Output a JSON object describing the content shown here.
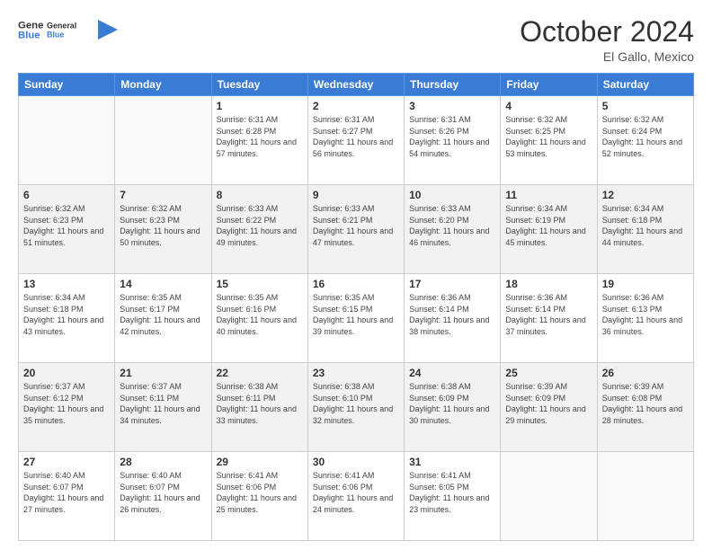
{
  "logo": {
    "line1": "General",
    "line2": "Blue"
  },
  "title": "October 2024",
  "subtitle": "El Gallo, Mexico",
  "days_header": [
    "Sunday",
    "Monday",
    "Tuesday",
    "Wednesday",
    "Thursday",
    "Friday",
    "Saturday"
  ],
  "weeks": [
    [
      {
        "day": "",
        "sunrise": "",
        "sunset": "",
        "daylight": ""
      },
      {
        "day": "",
        "sunrise": "",
        "sunset": "",
        "daylight": ""
      },
      {
        "day": "1",
        "sunrise": "Sunrise: 6:31 AM",
        "sunset": "Sunset: 6:28 PM",
        "daylight": "Daylight: 11 hours and 57 minutes."
      },
      {
        "day": "2",
        "sunrise": "Sunrise: 6:31 AM",
        "sunset": "Sunset: 6:27 PM",
        "daylight": "Daylight: 11 hours and 56 minutes."
      },
      {
        "day": "3",
        "sunrise": "Sunrise: 6:31 AM",
        "sunset": "Sunset: 6:26 PM",
        "daylight": "Daylight: 11 hours and 54 minutes."
      },
      {
        "day": "4",
        "sunrise": "Sunrise: 6:32 AM",
        "sunset": "Sunset: 6:25 PM",
        "daylight": "Daylight: 11 hours and 53 minutes."
      },
      {
        "day": "5",
        "sunrise": "Sunrise: 6:32 AM",
        "sunset": "Sunset: 6:24 PM",
        "daylight": "Daylight: 11 hours and 52 minutes."
      }
    ],
    [
      {
        "day": "6",
        "sunrise": "Sunrise: 6:32 AM",
        "sunset": "Sunset: 6:23 PM",
        "daylight": "Daylight: 11 hours and 51 minutes."
      },
      {
        "day": "7",
        "sunrise": "Sunrise: 6:32 AM",
        "sunset": "Sunset: 6:23 PM",
        "daylight": "Daylight: 11 hours and 50 minutes."
      },
      {
        "day": "8",
        "sunrise": "Sunrise: 6:33 AM",
        "sunset": "Sunset: 6:22 PM",
        "daylight": "Daylight: 11 hours and 49 minutes."
      },
      {
        "day": "9",
        "sunrise": "Sunrise: 6:33 AM",
        "sunset": "Sunset: 6:21 PM",
        "daylight": "Daylight: 11 hours and 47 minutes."
      },
      {
        "day": "10",
        "sunrise": "Sunrise: 6:33 AM",
        "sunset": "Sunset: 6:20 PM",
        "daylight": "Daylight: 11 hours and 46 minutes."
      },
      {
        "day": "11",
        "sunrise": "Sunrise: 6:34 AM",
        "sunset": "Sunset: 6:19 PM",
        "daylight": "Daylight: 11 hours and 45 minutes."
      },
      {
        "day": "12",
        "sunrise": "Sunrise: 6:34 AM",
        "sunset": "Sunset: 6:18 PM",
        "daylight": "Daylight: 11 hours and 44 minutes."
      }
    ],
    [
      {
        "day": "13",
        "sunrise": "Sunrise: 6:34 AM",
        "sunset": "Sunset: 6:18 PM",
        "daylight": "Daylight: 11 hours and 43 minutes."
      },
      {
        "day": "14",
        "sunrise": "Sunrise: 6:35 AM",
        "sunset": "Sunset: 6:17 PM",
        "daylight": "Daylight: 11 hours and 42 minutes."
      },
      {
        "day": "15",
        "sunrise": "Sunrise: 6:35 AM",
        "sunset": "Sunset: 6:16 PM",
        "daylight": "Daylight: 11 hours and 40 minutes."
      },
      {
        "day": "16",
        "sunrise": "Sunrise: 6:35 AM",
        "sunset": "Sunset: 6:15 PM",
        "daylight": "Daylight: 11 hours and 39 minutes."
      },
      {
        "day": "17",
        "sunrise": "Sunrise: 6:36 AM",
        "sunset": "Sunset: 6:14 PM",
        "daylight": "Daylight: 11 hours and 38 minutes."
      },
      {
        "day": "18",
        "sunrise": "Sunrise: 6:36 AM",
        "sunset": "Sunset: 6:14 PM",
        "daylight": "Daylight: 11 hours and 37 minutes."
      },
      {
        "day": "19",
        "sunrise": "Sunrise: 6:36 AM",
        "sunset": "Sunset: 6:13 PM",
        "daylight": "Daylight: 11 hours and 36 minutes."
      }
    ],
    [
      {
        "day": "20",
        "sunrise": "Sunrise: 6:37 AM",
        "sunset": "Sunset: 6:12 PM",
        "daylight": "Daylight: 11 hours and 35 minutes."
      },
      {
        "day": "21",
        "sunrise": "Sunrise: 6:37 AM",
        "sunset": "Sunset: 6:11 PM",
        "daylight": "Daylight: 11 hours and 34 minutes."
      },
      {
        "day": "22",
        "sunrise": "Sunrise: 6:38 AM",
        "sunset": "Sunset: 6:11 PM",
        "daylight": "Daylight: 11 hours and 33 minutes."
      },
      {
        "day": "23",
        "sunrise": "Sunrise: 6:38 AM",
        "sunset": "Sunset: 6:10 PM",
        "daylight": "Daylight: 11 hours and 32 minutes."
      },
      {
        "day": "24",
        "sunrise": "Sunrise: 6:38 AM",
        "sunset": "Sunset: 6:09 PM",
        "daylight": "Daylight: 11 hours and 30 minutes."
      },
      {
        "day": "25",
        "sunrise": "Sunrise: 6:39 AM",
        "sunset": "Sunset: 6:09 PM",
        "daylight": "Daylight: 11 hours and 29 minutes."
      },
      {
        "day": "26",
        "sunrise": "Sunrise: 6:39 AM",
        "sunset": "Sunset: 6:08 PM",
        "daylight": "Daylight: 11 hours and 28 minutes."
      }
    ],
    [
      {
        "day": "27",
        "sunrise": "Sunrise: 6:40 AM",
        "sunset": "Sunset: 6:07 PM",
        "daylight": "Daylight: 11 hours and 27 minutes."
      },
      {
        "day": "28",
        "sunrise": "Sunrise: 6:40 AM",
        "sunset": "Sunset: 6:07 PM",
        "daylight": "Daylight: 11 hours and 26 minutes."
      },
      {
        "day": "29",
        "sunrise": "Sunrise: 6:41 AM",
        "sunset": "Sunset: 6:06 PM",
        "daylight": "Daylight: 11 hours and 25 minutes."
      },
      {
        "day": "30",
        "sunrise": "Sunrise: 6:41 AM",
        "sunset": "Sunset: 6:06 PM",
        "daylight": "Daylight: 11 hours and 24 minutes."
      },
      {
        "day": "31",
        "sunrise": "Sunrise: 6:41 AM",
        "sunset": "Sunset: 6:05 PM",
        "daylight": "Daylight: 11 hours and 23 minutes."
      },
      {
        "day": "",
        "sunrise": "",
        "sunset": "",
        "daylight": ""
      },
      {
        "day": "",
        "sunrise": "",
        "sunset": "",
        "daylight": ""
      }
    ]
  ]
}
